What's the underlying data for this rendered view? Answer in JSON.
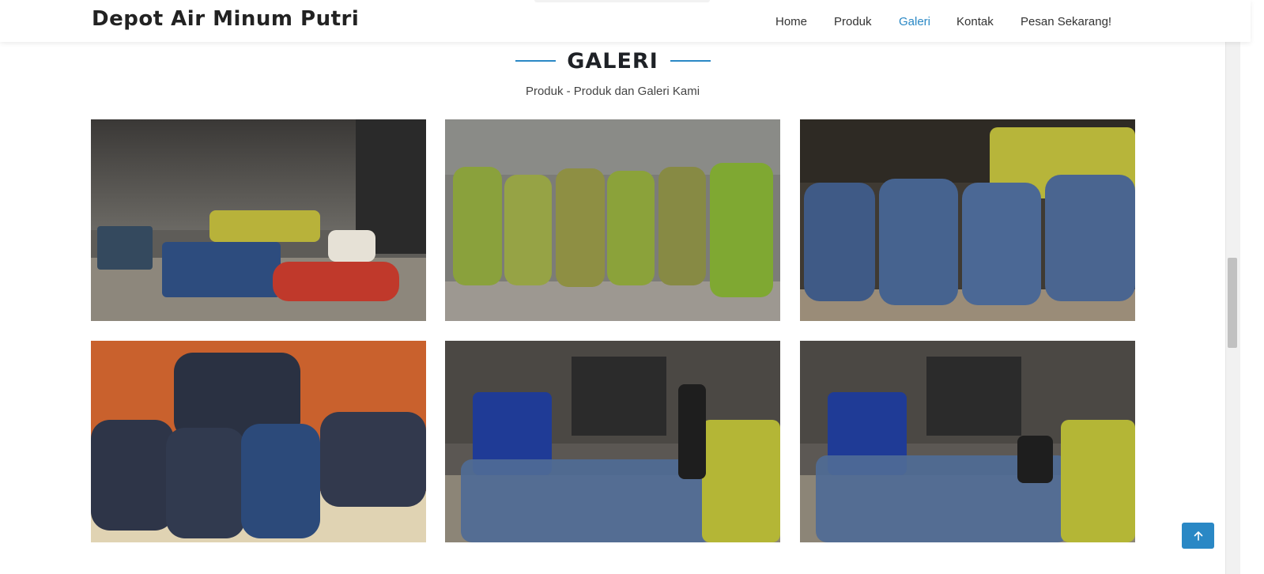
{
  "brand": "Depot Air Minum Putri",
  "nav": {
    "home": "Home",
    "produk": "Produk",
    "galeri": "Galeri",
    "kontak": "Kontak",
    "pesan": "Pesan Sekarang!"
  },
  "section": {
    "title": "GALERI",
    "subtitle": "Produk - Produk dan Galeri Kami"
  },
  "icons": {
    "back_to_top": "arrow-up-icon"
  },
  "colors": {
    "accent": "#2a88c5"
  }
}
